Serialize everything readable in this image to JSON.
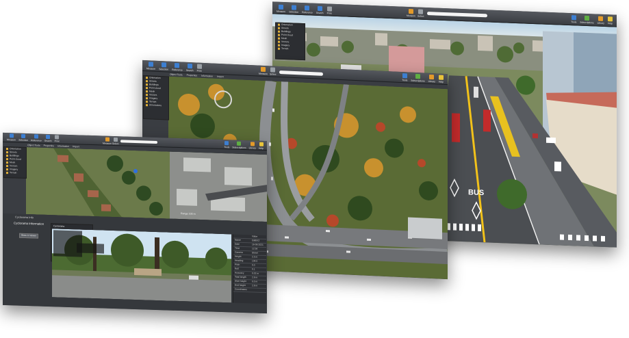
{
  "back_window": {
    "toolbar": [
      {
        "label": "Measure",
        "icon": "pointer-icon",
        "color": "#3d7fd1"
      },
      {
        "label": "Selection",
        "icon": "select-icon",
        "color": "#3d7fd1"
      },
      {
        "label": "Reference",
        "icon": "reference-icon",
        "color": "#3d7fd1"
      },
      {
        "label": "Search",
        "icon": "search-icon",
        "color": "#3d7fd1"
      },
      {
        "label": "Print",
        "icon": "print-icon",
        "color": "#9aa0a6"
      }
    ],
    "center_tools": [
      {
        "label": "Measure",
        "icon": "ruler-icon",
        "color": "#e39a2a"
      },
      {
        "label": "Select",
        "icon": "cursor-icon",
        "color": "#9aa0a6"
      }
    ],
    "right_tools": [
      {
        "label": "Tools",
        "icon": "tools-icon",
        "color": "#3d7fd1"
      },
      {
        "label": "Subscriptions",
        "icon": "subscriptions-icon",
        "color": "#5fae43"
      },
      {
        "label": "Library",
        "icon": "library-icon",
        "color": "#e39a2a"
      },
      {
        "label": "Help",
        "icon": "help-icon",
        "color": "#e8c43a"
      }
    ],
    "tree": [
      "Orientation",
      "Streets",
      "Buildings",
      "Point cloud",
      "Mesh",
      "Vectors",
      "Imagery",
      "Terrain",
      "Annotations"
    ],
    "road_text": "BUS"
  },
  "middle_window": {
    "toolbar": [
      {
        "label": "Measure",
        "icon": "pointer-icon",
        "color": "#3d7fd1"
      },
      {
        "label": "Selection",
        "icon": "select-icon",
        "color": "#3d7fd1"
      },
      {
        "label": "Reference",
        "icon": "reference-icon",
        "color": "#3d7fd1"
      },
      {
        "label": "Search",
        "icon": "search-icon",
        "color": "#3d7fd1"
      },
      {
        "label": "Print",
        "icon": "print-icon",
        "color": "#9aa0a6"
      }
    ],
    "center_tools": [
      {
        "label": "Measure",
        "icon": "ruler-icon",
        "color": "#e39a2a"
      },
      {
        "label": "Select",
        "icon": "cursor-icon",
        "color": "#9aa0a6"
      }
    ],
    "right_tools": [
      {
        "label": "Tools",
        "icon": "tools-icon",
        "color": "#3d7fd1"
      },
      {
        "label": "Subscriptions",
        "icon": "subscriptions-icon",
        "color": "#5fae43"
      },
      {
        "label": "Library",
        "icon": "library-icon",
        "color": "#e39a2a"
      },
      {
        "label": "Help",
        "icon": "help-icon",
        "color": "#e8c43a"
      }
    ],
    "tabs": [
      "Object Tools",
      "Properties",
      "Information",
      "Import"
    ],
    "tree": [
      "Orientation",
      "Streets",
      "Buildings",
      "Point cloud",
      "Mesh",
      "Vectors",
      "Imagery",
      "Terrain",
      "Annotations"
    ]
  },
  "front_window": {
    "toolbar": [
      {
        "label": "Measure",
        "icon": "pointer-icon",
        "color": "#3d7fd1"
      },
      {
        "label": "Selection",
        "icon": "select-icon",
        "color": "#3d7fd1"
      },
      {
        "label": "Reference",
        "icon": "reference-icon",
        "color": "#3d7fd1"
      },
      {
        "label": "Search",
        "icon": "search-icon",
        "color": "#3d7fd1"
      },
      {
        "label": "Print",
        "icon": "print-icon",
        "color": "#9aa0a6"
      }
    ],
    "center_tools": [
      {
        "label": "Measure",
        "icon": "ruler-icon",
        "color": "#e39a2a"
      },
      {
        "label": "Select",
        "icon": "cursor-icon",
        "color": "#9aa0a6"
      }
    ],
    "right_tools": [
      {
        "label": "Tools",
        "icon": "tools-icon",
        "color": "#3d7fd1"
      },
      {
        "label": "Subscriptions",
        "icon": "subscriptions-icon",
        "color": "#5fae43"
      },
      {
        "label": "Library",
        "icon": "library-icon",
        "color": "#e39a2a"
      },
      {
        "label": "Help",
        "icon": "help-icon",
        "color": "#e8c43a"
      }
    ],
    "tabs": [
      "Object Tools",
      "Properties",
      "Information",
      "Import"
    ],
    "tree": [
      "Orientation",
      "Streets",
      "Buildings",
      "Point cloud",
      "Mesh",
      "Vectors",
      "Imagery",
      "Terrain"
    ],
    "status": "Range 100 m",
    "panel_title": "Cyclorama Info",
    "panel_heading": "Cyclorama Information",
    "panel_button": "Show in Viewer",
    "list_header": "Cyclorama",
    "props_header": "Value",
    "props": [
      {
        "k": "Name",
        "v": "GM5X2"
      },
      {
        "k": "Date",
        "v": "16-06-2021"
      },
      {
        "k": "Time",
        "v": "12:34"
      },
      {
        "k": "Camera",
        "v": "Street"
      },
      {
        "k": "Height",
        "v": "2.5 m"
      },
      {
        "k": "Heading",
        "v": "134.5"
      },
      {
        "k": "Pitch",
        "v": "0.0"
      },
      {
        "k": "Roll",
        "v": "0.1"
      },
      {
        "k": "Accuracy",
        "v": "0.02 m"
      },
      {
        "k": "Total length",
        "v": "2.8 m"
      },
      {
        "k": "Start height",
        "v": "0.0 m"
      },
      {
        "k": "End height",
        "v": "2.8 m"
      },
      {
        "k": "Coordinates",
        "v": ""
      }
    ]
  }
}
